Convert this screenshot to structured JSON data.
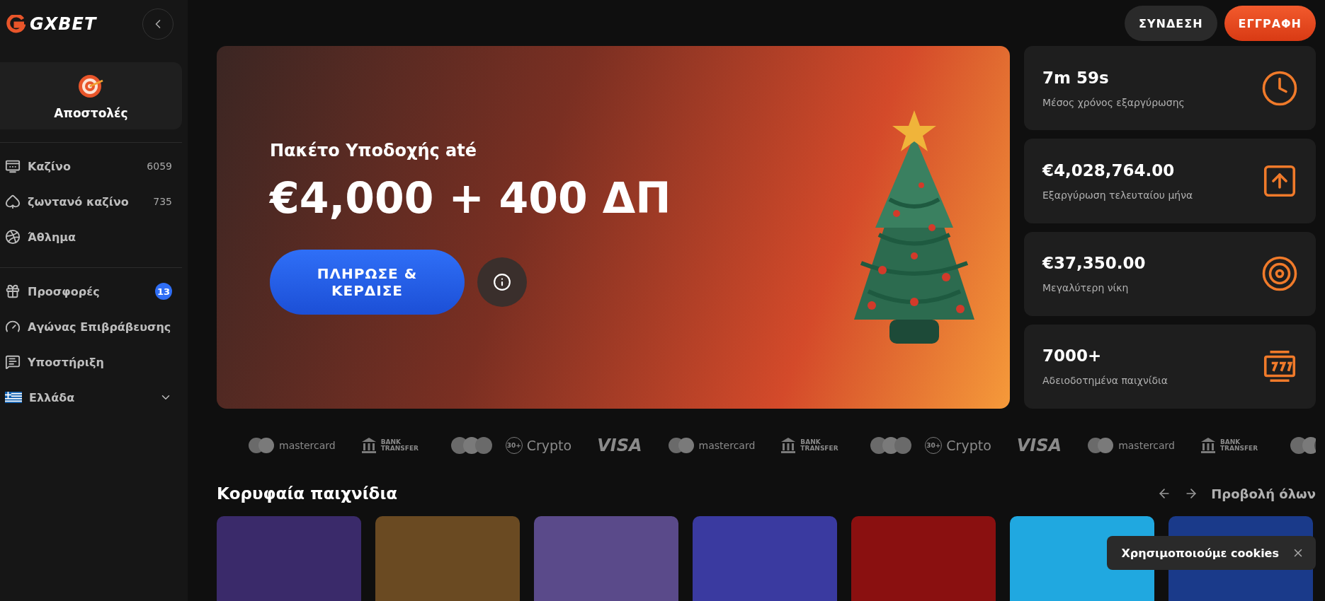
{
  "header": {
    "logo": "GXBET",
    "buttons": [
      {
        "label": "ΣΥΝΔΕΣΗ",
        "kind": "secondary"
      },
      {
        "label": "ΕΓΓΡΑΦΗ",
        "kind": "primary"
      }
    ]
  },
  "sidebar": {
    "missions": {
      "label": "Αποστολές"
    },
    "groups": [
      [
        {
          "label": "Καζίνο",
          "count": "6059"
        },
        {
          "label": "ζωντανό καζίνο",
          "count": "735"
        },
        {
          "label": "Άθλημα"
        }
      ],
      [
        {
          "label": "Προσφορές",
          "badge": "13"
        },
        {
          "label": "Αγώνας Επιβράβευσης"
        },
        {
          "label": "Υποστήριξη"
        }
      ]
    ],
    "language": {
      "label": "Ελλάδα",
      "expanded": false
    }
  },
  "banner": {
    "subtitle": "Πακέτο Υποδοχής até",
    "headline": "€4,000 + 400 ΔΠ",
    "cta": "ΠΛΗΡΩΣΕ & ΚΕΡΔΙΣΕ"
  },
  "stats": [
    {
      "value": "7m 59s",
      "label": "Μέσος χρόνος εξαργύρωσης"
    },
    {
      "value": "€4,028,764.00",
      "label": "Εξαργύρωση τελευταίου μήνα"
    },
    {
      "value": "€37,350.00",
      "label": "Μεγαλύτερη νίκη"
    },
    {
      "value": "7000+",
      "label": "Αδειοδοτημένα παιχνίδια"
    }
  ],
  "payments": [
    {
      "kind": "mastercard",
      "label": "mastercard"
    },
    {
      "kind": "bank",
      "label": "BANK TRANSFER"
    },
    {
      "kind": "crypto",
      "label": "Crypto",
      "badge": "30+"
    },
    {
      "kind": "visa",
      "label": "VISA"
    },
    {
      "kind": "mastercard",
      "label": "mastercard"
    },
    {
      "kind": "bank",
      "label": "BANK TRANSFER"
    },
    {
      "kind": "crypto",
      "label": "Crypto",
      "badge": "30+"
    },
    {
      "kind": "visa",
      "label": "VISA"
    },
    {
      "kind": "mastercard",
      "label": "mastercard"
    },
    {
      "kind": "bank",
      "label": "BANK TRANSFER"
    },
    {
      "kind": "coins"
    }
  ],
  "games": {
    "title": "Κορυφαία παιχνίδια",
    "view_all": "Προβολή όλων",
    "tiles": [
      {
        "color": "#3a2a6a"
      },
      {
        "color": "#6a4a22"
      },
      {
        "color": "#5a4a8a"
      },
      {
        "color": "#3a3aa0"
      },
      {
        "color": "#8a1010"
      },
      {
        "color": "#20a8e0"
      },
      {
        "color": "#1a3a8a"
      }
    ]
  },
  "cookie": {
    "text": "Χρησιμοποιούμε cookies"
  }
}
